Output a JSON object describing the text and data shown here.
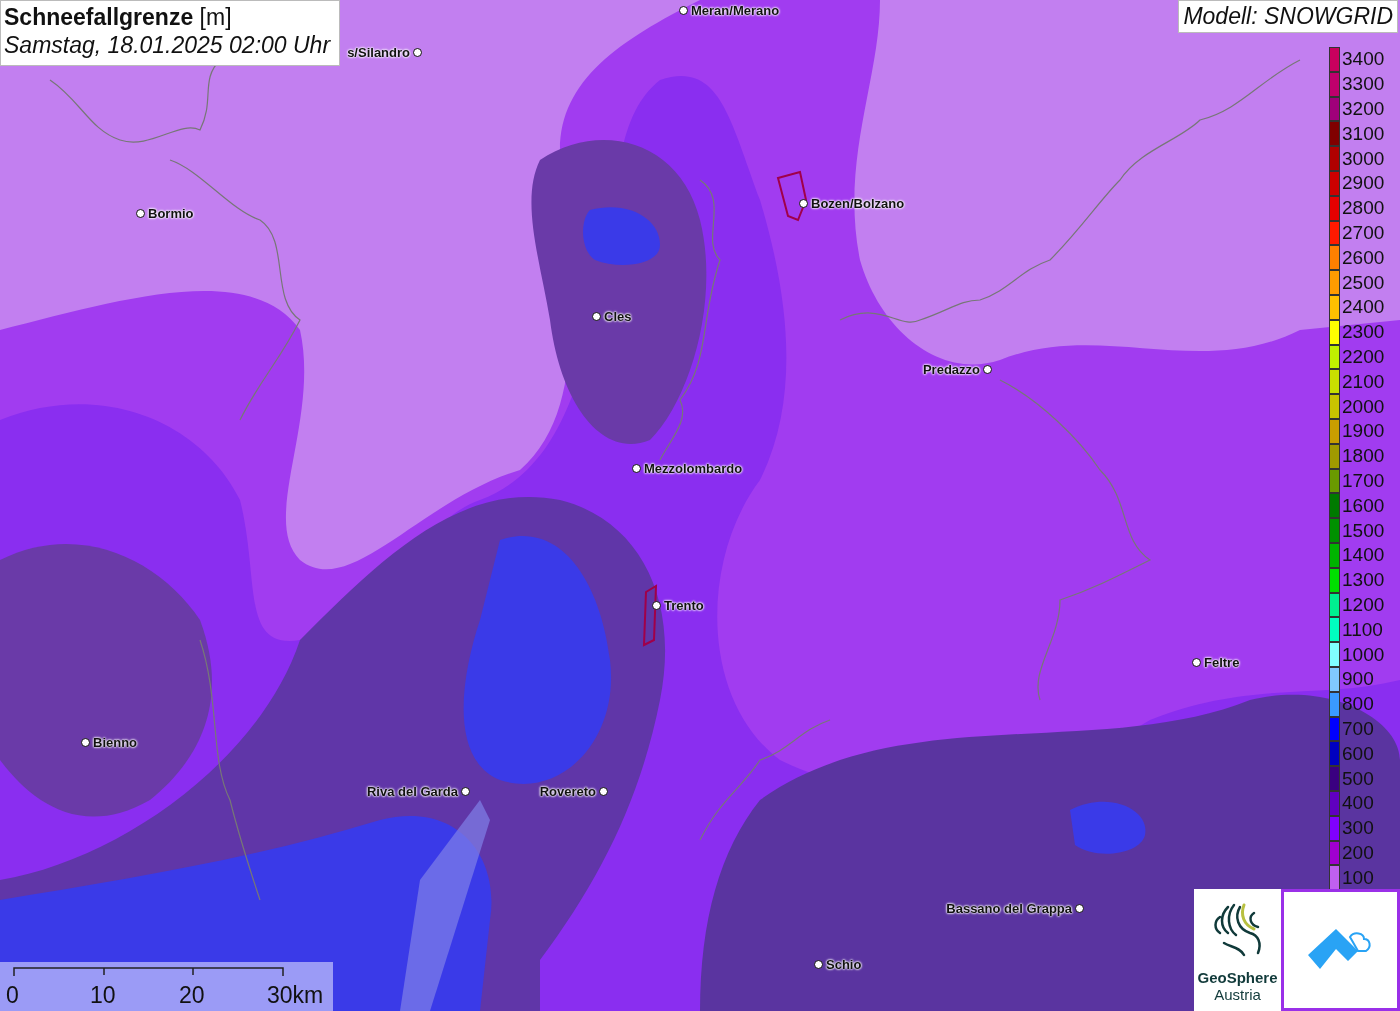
{
  "title": {
    "name": "Schneefallgrenze",
    "unit": "[m]",
    "datetime": "Samstag, 18.01.2025 02:00 Uhr"
  },
  "model": "Modell: SNOWGRID",
  "legend": [
    {
      "label": "3400",
      "color": "#c8005e"
    },
    {
      "label": "3300",
      "color": "#c0006c"
    },
    {
      "label": "3200",
      "color": "#a0007a"
    },
    {
      "label": "3100",
      "color": "#800000"
    },
    {
      "label": "3000",
      "color": "#b00000"
    },
    {
      "label": "2900",
      "color": "#cc0000"
    },
    {
      "label": "2800",
      "color": "#e60000"
    },
    {
      "label": "2700",
      "color": "#ff1a00"
    },
    {
      "label": "2600",
      "color": "#ff8000"
    },
    {
      "label": "2500",
      "color": "#ff9c00"
    },
    {
      "label": "2400",
      "color": "#ffc000"
    },
    {
      "label": "2300",
      "color": "#ffff00"
    },
    {
      "label": "2200",
      "color": "#c0f000"
    },
    {
      "label": "2100",
      "color": "#c8e000"
    },
    {
      "label": "2000",
      "color": "#c8c400"
    },
    {
      "label": "1900",
      "color": "#c89e00"
    },
    {
      "label": "1800",
      "color": "#a09a00"
    },
    {
      "label": "1700",
      "color": "#6a9a00"
    },
    {
      "label": "1600",
      "color": "#007a00"
    },
    {
      "label": "1500",
      "color": "#009000"
    },
    {
      "label": "1400",
      "color": "#00b400"
    },
    {
      "label": "1300",
      "color": "#00e000"
    },
    {
      "label": "1200",
      "color": "#00f090"
    },
    {
      "label": "1100",
      "color": "#00ffc0"
    },
    {
      "label": "1000",
      "color": "#80ffff"
    },
    {
      "label": "900",
      "color": "#80c8ff"
    },
    {
      "label": "800",
      "color": "#3a9aff"
    },
    {
      "label": "700",
      "color": "#0000ff"
    },
    {
      "label": "600",
      "color": "#0000c0"
    },
    {
      "label": "500",
      "color": "#3a0080"
    },
    {
      "label": "400",
      "color": "#6000c0"
    },
    {
      "label": "300",
      "color": "#8000ff"
    },
    {
      "label": "200",
      "color": "#a000d0"
    },
    {
      "label": "100",
      "color": "#c060f0"
    }
  ],
  "cities": [
    {
      "name": "Meran/Merano"
    },
    {
      "name": "s/Silandro"
    },
    {
      "name": "Bormio"
    },
    {
      "name": "Bozen/Bolzano"
    },
    {
      "name": "Cles"
    },
    {
      "name": "Predazzo"
    },
    {
      "name": "Mezzolombardo"
    },
    {
      "name": "Trento"
    },
    {
      "name": "Feltre"
    },
    {
      "name": "Bienno"
    },
    {
      "name": "Riva del Garda"
    },
    {
      "name": "Rovereto"
    },
    {
      "name": "Bassano del Grappa"
    },
    {
      "name": "Schio"
    }
  ],
  "scale_bar": [
    "0",
    "10",
    "20",
    "30km"
  ],
  "logo": {
    "name": "GeoSphere",
    "sub": "Austria"
  }
}
